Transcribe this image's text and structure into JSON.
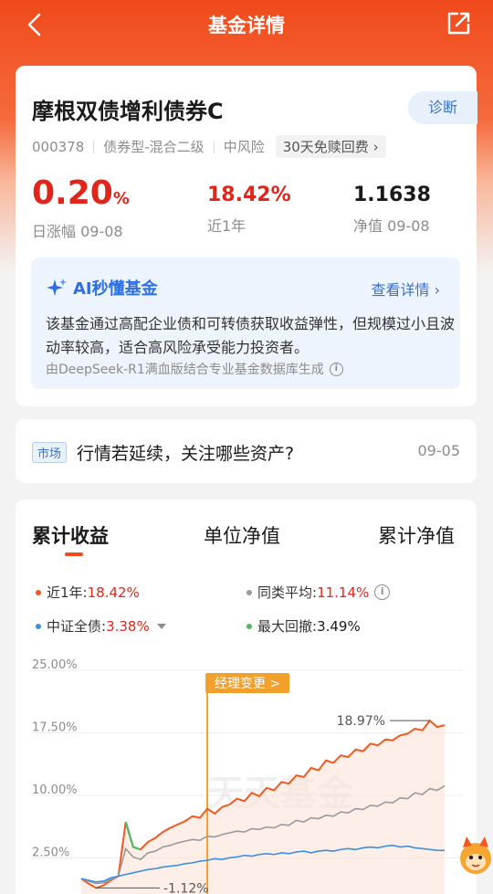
{
  "header": {
    "title": "基金详情",
    "back_icon": "back-icon",
    "share_icon": "share-icon"
  },
  "fund": {
    "name": "摩根双债增利债券C",
    "code": "000378",
    "type": "债券型-混合二级",
    "risk": "中风险",
    "fee_badge": "30天免赎回费",
    "diagnose_label": "诊断",
    "daily_change": "0.20",
    "daily_change_unit": "%",
    "daily_change_label": "日涨幅 09-08",
    "year_return": "18.42%",
    "year_return_label": "近1年",
    "nav": "1.1638",
    "nav_label": "净值 09-08"
  },
  "ai": {
    "title": "AI秒懂基金",
    "more": "查看详情",
    "text": "该基金通过高配企业债和可转债获取收益弹性，但规模过小且波动率较高，适合高风险承受能力投资者。",
    "source": "由DeepSeek-R1满血版结合专业基金数据库生成"
  },
  "market": {
    "tag": "市场",
    "text": "行情若延续，关注哪些资产?",
    "date": "09-05"
  },
  "tabs": [
    "累计收益",
    "单位净值",
    "累计净值"
  ],
  "legend": {
    "fund_label": "近1年:",
    "fund_value": "18.42%",
    "peer_label": "同类平均:",
    "peer_value": "11.14%",
    "index_label": "中证全债:",
    "index_value": "3.38%",
    "drawdown_label": "最大回撤:",
    "drawdown_value": "3.49%"
  },
  "colors": {
    "fund": "#f05a22",
    "peer": "#9a9a9a",
    "index": "#3b8fe0",
    "drawdown": "#4cbb5c",
    "accent": "#f04a1c",
    "manager": "#f2a02c"
  },
  "chart_data": {
    "type": "line",
    "ylim": [
      -2.5,
      26
    ],
    "yticks": [
      "25.00%",
      "17.50%",
      "10.00%",
      "2.50%"
    ],
    "ytick_values": [
      25,
      17.5,
      10,
      2.5
    ],
    "annotation_max": "18.97%",
    "annotation_min": "-1.12%",
    "manager_change_label": "经理变更 >",
    "watermark": "天天基金",
    "series": [
      {
        "name": "近1年",
        "values": [
          0,
          -0.6,
          -1.12,
          -0.8,
          -0.2,
          0.3,
          6.8,
          3.8,
          3.5,
          4.4,
          4.9,
          5.6,
          6.1,
          6.5,
          6.9,
          7.5,
          7.3,
          8.4,
          7.8,
          8.6,
          8.9,
          9.6,
          9.3,
          10.3,
          9.9,
          10.9,
          10.6,
          11.6,
          11.4,
          12.4,
          12.2,
          13.3,
          13.0,
          14.2,
          13.9,
          14.8,
          14.6,
          15.5,
          15.3,
          16.2,
          16.0,
          16.7,
          16.6,
          17.2,
          17.4,
          18.0,
          17.8,
          18.97,
          18.2,
          18.42
        ]
      },
      {
        "name": "同类平均",
        "values": [
          0,
          -0.3,
          -0.6,
          -0.5,
          -0.1,
          0.3,
          3.6,
          2.6,
          2.3,
          3.1,
          3.3,
          3.8,
          4.0,
          4.3,
          4.5,
          4.7,
          4.6,
          5.1,
          5.0,
          5.3,
          5.5,
          5.7,
          5.6,
          6.0,
          5.9,
          6.2,
          6.1,
          6.5,
          6.4,
          7.0,
          6.8,
          7.3,
          7.2,
          7.6,
          7.5,
          8.0,
          7.9,
          8.4,
          8.3,
          8.8,
          8.7,
          9.2,
          9.1,
          9.7,
          9.6,
          10.3,
          10.1,
          10.8,
          10.6,
          11.14
        ]
      },
      {
        "name": "中证全债",
        "values": [
          0,
          -0.2,
          -0.4,
          -0.3,
          0.1,
          0.3,
          0.5,
          0.7,
          0.9,
          1.1,
          1.2,
          1.4,
          1.5,
          1.6,
          1.8,
          1.9,
          2.1,
          2.2,
          2.4,
          2.3,
          2.5,
          2.6,
          2.8,
          2.7,
          2.9,
          3.0,
          2.9,
          3.1,
          3.0,
          3.2,
          3.3,
          3.1,
          3.3,
          3.4,
          3.3,
          3.5,
          3.6,
          3.5,
          3.7,
          3.8,
          3.7,
          3.9,
          4.0,
          3.8,
          3.9,
          3.7,
          3.6,
          3.5,
          3.4,
          3.38
        ]
      }
    ],
    "manager_change_index": 17
  }
}
